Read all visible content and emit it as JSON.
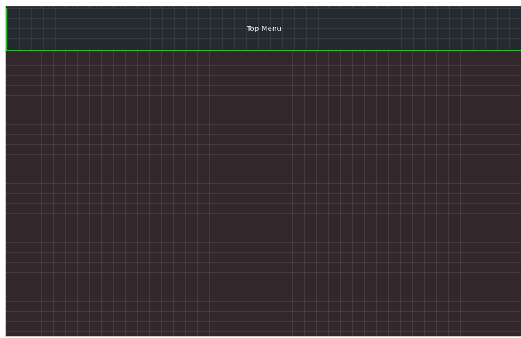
{
  "top_menu": {
    "label": "Top Menu"
  }
}
